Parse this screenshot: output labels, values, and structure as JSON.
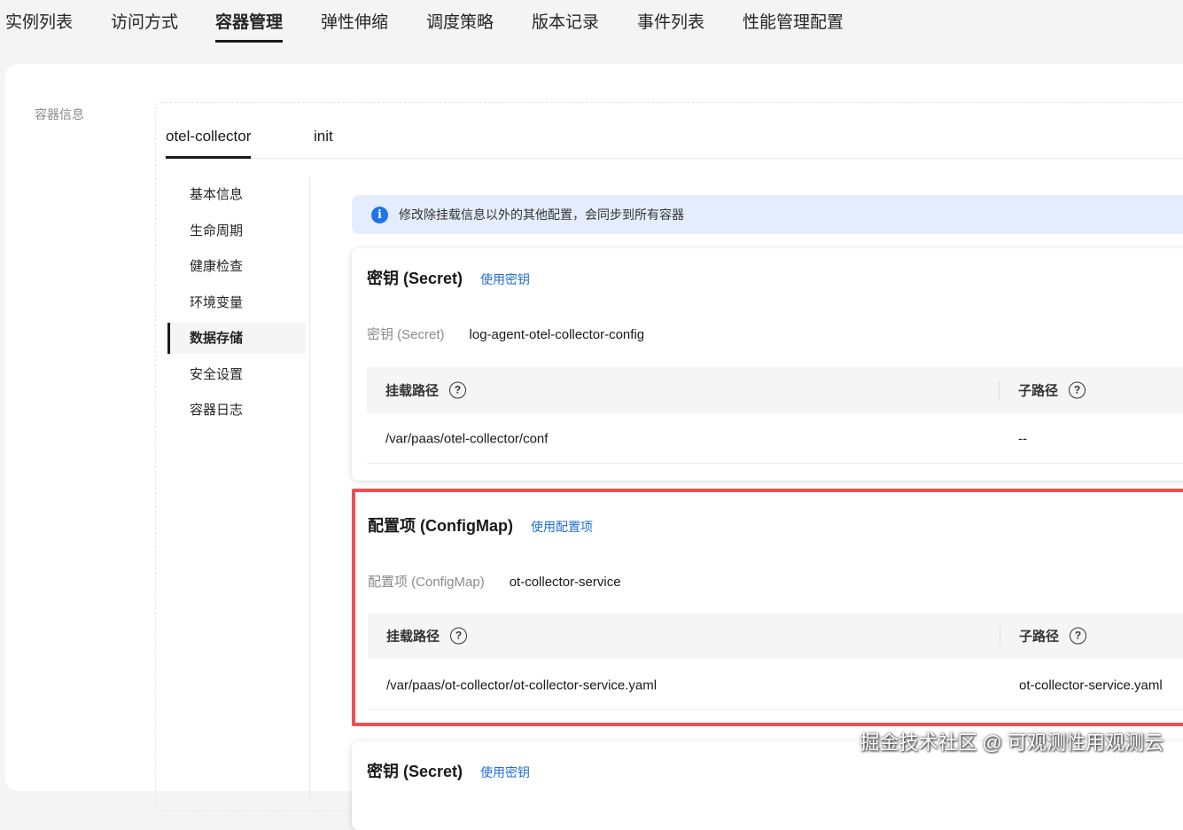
{
  "top_tabs": [
    "实例列表",
    "访问方式",
    "容器管理",
    "弹性伸缩",
    "调度策略",
    "版本记录",
    "事件列表",
    "性能管理配置"
  ],
  "section_label": "容器信息",
  "container_tabs": [
    "otel-collector",
    "init"
  ],
  "left_nav": [
    "基本信息",
    "生命周期",
    "健康检查",
    "环境变量",
    "数据存储",
    "安全设置",
    "容器日志"
  ],
  "banner": "修改除挂载信息以外的其他配置，会同步到所有容器",
  "cards": [
    {
      "title": "密钥 (Secret)",
      "link": "使用密钥",
      "key": "密钥 (Secret)",
      "value": "log-agent-otel-collector-config",
      "col1": "挂载路径",
      "col2": "子路径",
      "path": "/var/paas/otel-collector/conf",
      "subpath": "--"
    },
    {
      "title": "配置项 (ConfigMap)",
      "link": "使用配置项",
      "key": "配置项 (ConfigMap)",
      "value": "ot-collector-service",
      "col1": "挂载路径",
      "col2": "子路径",
      "path": "/var/paas/ot-collector/ot-collector-service.yaml",
      "subpath": "ot-collector-service.yaml"
    },
    {
      "title": "密钥 (Secret)",
      "link": "使用密钥"
    }
  ],
  "help_glyph": "?",
  "watermark": "掘金技术社区 @ 可观测性用观测云"
}
